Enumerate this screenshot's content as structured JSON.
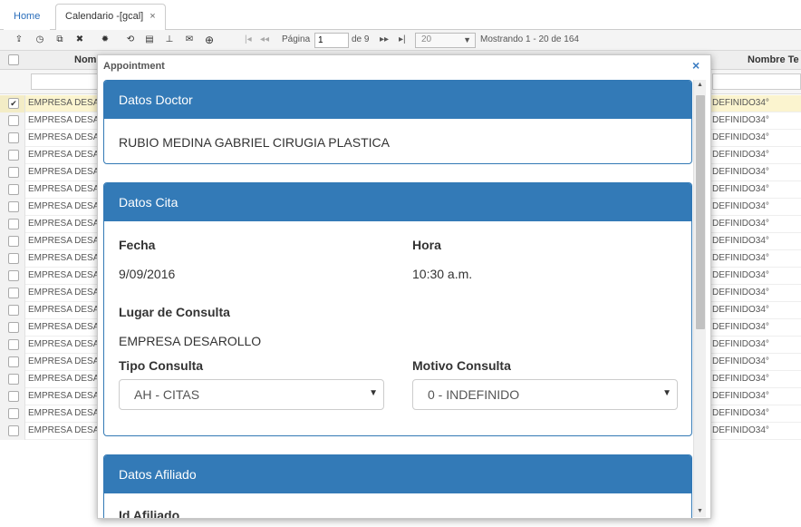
{
  "tabs": [
    {
      "label": "Home"
    },
    {
      "label": "Calendario -[gcal]",
      "close": "×"
    }
  ],
  "toolbar": {
    "icons": [
      "export-icon",
      "clock-icon",
      "copy-icon",
      "delete-icon",
      "settings-icon",
      "refresh-icon",
      "comment-icon",
      "pin-icon",
      "mail-icon",
      "add-icon"
    ],
    "page_label": "Página",
    "page_value": "1",
    "page_of": "de 9",
    "rows_per_page": "20",
    "showing": "Mostrando 1 - 20 de 164",
    "nav_first": "|◂",
    "nav_prev": "◂◂",
    "nav_next": "▸▸",
    "nav_last": "▸|"
  },
  "grid": {
    "col1_header": "Nom",
    "col2_header": "Nombre Te",
    "rows": [
      {
        "c1": "EMPRESA DESA",
        "c2": "DEFINIDO34°",
        "checked": "✔"
      },
      {
        "c1": "EMPRESA DESA",
        "c2": "DEFINIDO34°",
        "checked": ""
      },
      {
        "c1": "EMPRESA DESA",
        "c2": "DEFINIDO34°",
        "checked": ""
      },
      {
        "c1": "EMPRESA DESA",
        "c2": "DEFINIDO34°",
        "checked": ""
      },
      {
        "c1": "EMPRESA DESA",
        "c2": "DEFINIDO34°",
        "checked": ""
      },
      {
        "c1": "EMPRESA DESA",
        "c2": "DEFINIDO34°",
        "checked": ""
      },
      {
        "c1": "EMPRESA DESA",
        "c2": "DEFINIDO34°",
        "checked": ""
      },
      {
        "c1": "EMPRESA DESA",
        "c2": "DEFINIDO34°",
        "checked": ""
      },
      {
        "c1": "EMPRESA DESA",
        "c2": "DEFINIDO34°",
        "checked": ""
      },
      {
        "c1": "EMPRESA DESA",
        "c2": "DEFINIDO34°",
        "checked": ""
      },
      {
        "c1": "EMPRESA DESA",
        "c2": "DEFINIDO34°",
        "checked": ""
      },
      {
        "c1": "EMPRESA DESA",
        "c2": "DEFINIDO34°",
        "checked": ""
      },
      {
        "c1": "EMPRESA DESA",
        "c2": "DEFINIDO34°",
        "checked": ""
      },
      {
        "c1": "EMPRESA DESA",
        "c2": "DEFINIDO34°",
        "checked": ""
      },
      {
        "c1": "EMPRESA DESA",
        "c2": "DEFINIDO34°",
        "checked": ""
      },
      {
        "c1": "EMPRESA DESA",
        "c2": "DEFINIDO34°",
        "checked": ""
      },
      {
        "c1": "EMPRESA DESA",
        "c2": "DEFINIDO34°",
        "checked": ""
      },
      {
        "c1": "EMPRESA DESA",
        "c2": "DEFINIDO34°",
        "checked": ""
      },
      {
        "c1": "EMPRESA DESA",
        "c2": "DEFINIDO34°",
        "checked": ""
      },
      {
        "c1": "EMPRESA DESA",
        "c2": "DEFINIDO34°",
        "checked": ""
      }
    ]
  },
  "modal": {
    "title": "Appointment",
    "close": "×",
    "doctor": {
      "header": "Datos Doctor",
      "name": "RUBIO MEDINA GABRIEL CIRUGIA PLASTICA"
    },
    "cita": {
      "header": "Datos Cita",
      "fecha_label": "Fecha",
      "fecha_value": "9/09/2016",
      "hora_label": "Hora",
      "hora_value": "10:30 a.m.",
      "lugar_label": "Lugar de Consulta",
      "lugar_value": "EMPRESA DESAROLLO",
      "tipo_label": "Tipo Consulta",
      "tipo_value": "AH - CITAS",
      "motivo_label": "Motivo Consulta",
      "motivo_value": "0 - INDEFINIDO"
    },
    "afiliado": {
      "header": "Datos Afiliado",
      "id_label": "Id Afiliado"
    }
  },
  "colors": {
    "panel_header": "#337ab7",
    "selected_row": "#fbf4cf",
    "link": "#2a6ebb"
  }
}
